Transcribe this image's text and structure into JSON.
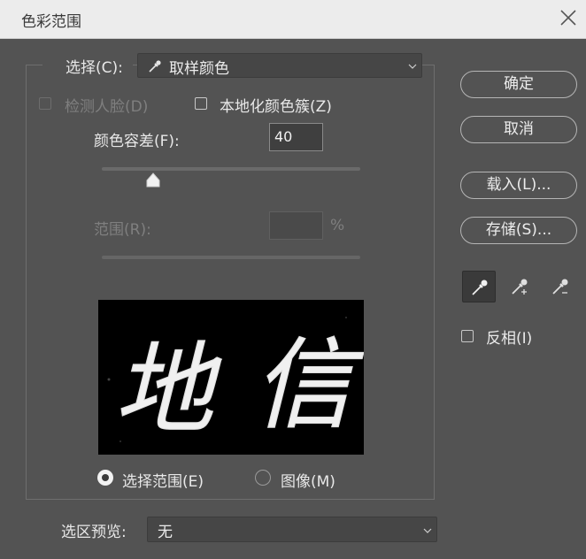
{
  "window": {
    "title": "色彩范围"
  },
  "select_row": {
    "label": "选择(C):",
    "value": "取样颜色"
  },
  "options": {
    "detect_faces": "检测人脸(D)",
    "localized_clusters": "本地化颜色簇(Z)"
  },
  "fuzziness": {
    "label": "颜色容差(F):",
    "value": "40",
    "slider_fraction": 0.2
  },
  "range": {
    "label": "范围(R):",
    "value": "",
    "unit": "%"
  },
  "preview_mode": {
    "selection": "选择范围(E)",
    "image": "图像(M)",
    "selected": "selection"
  },
  "preview_text": {
    "char1": "地",
    "char2": "信"
  },
  "selection_preview": {
    "label": "选区预览:",
    "value": "无"
  },
  "buttons": {
    "ok": "确定",
    "cancel": "取消",
    "load": "载入(L)...",
    "save": "存储(S)..."
  },
  "tools": [
    "eyedropper-icon",
    "eyedropper-plus-icon",
    "eyedropper-minus-icon"
  ],
  "invert": {
    "label": "反相(I)"
  }
}
